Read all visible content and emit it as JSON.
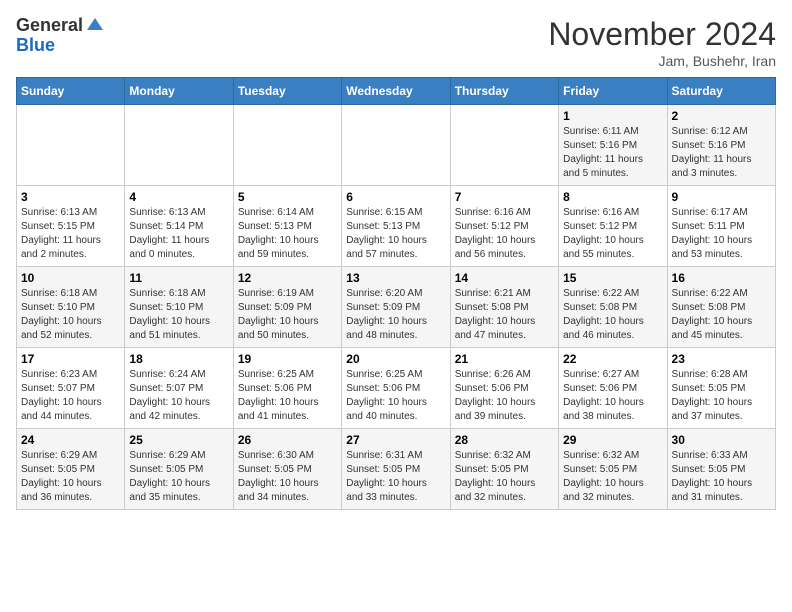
{
  "logo": {
    "general": "General",
    "blue": "Blue"
  },
  "header": {
    "month": "November 2024",
    "location": "Jam, Bushehr, Iran"
  },
  "weekdays": [
    "Sunday",
    "Monday",
    "Tuesday",
    "Wednesday",
    "Thursday",
    "Friday",
    "Saturday"
  ],
  "weeks": [
    [
      {
        "day": "",
        "info": ""
      },
      {
        "day": "",
        "info": ""
      },
      {
        "day": "",
        "info": ""
      },
      {
        "day": "",
        "info": ""
      },
      {
        "day": "",
        "info": ""
      },
      {
        "day": "1",
        "info": "Sunrise: 6:11 AM\nSunset: 5:16 PM\nDaylight: 11 hours\nand 5 minutes."
      },
      {
        "day": "2",
        "info": "Sunrise: 6:12 AM\nSunset: 5:16 PM\nDaylight: 11 hours\nand 3 minutes."
      }
    ],
    [
      {
        "day": "3",
        "info": "Sunrise: 6:13 AM\nSunset: 5:15 PM\nDaylight: 11 hours\nand 2 minutes."
      },
      {
        "day": "4",
        "info": "Sunrise: 6:13 AM\nSunset: 5:14 PM\nDaylight: 11 hours\nand 0 minutes."
      },
      {
        "day": "5",
        "info": "Sunrise: 6:14 AM\nSunset: 5:13 PM\nDaylight: 10 hours\nand 59 minutes."
      },
      {
        "day": "6",
        "info": "Sunrise: 6:15 AM\nSunset: 5:13 PM\nDaylight: 10 hours\nand 57 minutes."
      },
      {
        "day": "7",
        "info": "Sunrise: 6:16 AM\nSunset: 5:12 PM\nDaylight: 10 hours\nand 56 minutes."
      },
      {
        "day": "8",
        "info": "Sunrise: 6:16 AM\nSunset: 5:12 PM\nDaylight: 10 hours\nand 55 minutes."
      },
      {
        "day": "9",
        "info": "Sunrise: 6:17 AM\nSunset: 5:11 PM\nDaylight: 10 hours\nand 53 minutes."
      }
    ],
    [
      {
        "day": "10",
        "info": "Sunrise: 6:18 AM\nSunset: 5:10 PM\nDaylight: 10 hours\nand 52 minutes."
      },
      {
        "day": "11",
        "info": "Sunrise: 6:18 AM\nSunset: 5:10 PM\nDaylight: 10 hours\nand 51 minutes."
      },
      {
        "day": "12",
        "info": "Sunrise: 6:19 AM\nSunset: 5:09 PM\nDaylight: 10 hours\nand 50 minutes."
      },
      {
        "day": "13",
        "info": "Sunrise: 6:20 AM\nSunset: 5:09 PM\nDaylight: 10 hours\nand 48 minutes."
      },
      {
        "day": "14",
        "info": "Sunrise: 6:21 AM\nSunset: 5:08 PM\nDaylight: 10 hours\nand 47 minutes."
      },
      {
        "day": "15",
        "info": "Sunrise: 6:22 AM\nSunset: 5:08 PM\nDaylight: 10 hours\nand 46 minutes."
      },
      {
        "day": "16",
        "info": "Sunrise: 6:22 AM\nSunset: 5:08 PM\nDaylight: 10 hours\nand 45 minutes."
      }
    ],
    [
      {
        "day": "17",
        "info": "Sunrise: 6:23 AM\nSunset: 5:07 PM\nDaylight: 10 hours\nand 44 minutes."
      },
      {
        "day": "18",
        "info": "Sunrise: 6:24 AM\nSunset: 5:07 PM\nDaylight: 10 hours\nand 42 minutes."
      },
      {
        "day": "19",
        "info": "Sunrise: 6:25 AM\nSunset: 5:06 PM\nDaylight: 10 hours\nand 41 minutes."
      },
      {
        "day": "20",
        "info": "Sunrise: 6:25 AM\nSunset: 5:06 PM\nDaylight: 10 hours\nand 40 minutes."
      },
      {
        "day": "21",
        "info": "Sunrise: 6:26 AM\nSunset: 5:06 PM\nDaylight: 10 hours\nand 39 minutes."
      },
      {
        "day": "22",
        "info": "Sunrise: 6:27 AM\nSunset: 5:06 PM\nDaylight: 10 hours\nand 38 minutes."
      },
      {
        "day": "23",
        "info": "Sunrise: 6:28 AM\nSunset: 5:05 PM\nDaylight: 10 hours\nand 37 minutes."
      }
    ],
    [
      {
        "day": "24",
        "info": "Sunrise: 6:29 AM\nSunset: 5:05 PM\nDaylight: 10 hours\nand 36 minutes."
      },
      {
        "day": "25",
        "info": "Sunrise: 6:29 AM\nSunset: 5:05 PM\nDaylight: 10 hours\nand 35 minutes."
      },
      {
        "day": "26",
        "info": "Sunrise: 6:30 AM\nSunset: 5:05 PM\nDaylight: 10 hours\nand 34 minutes."
      },
      {
        "day": "27",
        "info": "Sunrise: 6:31 AM\nSunset: 5:05 PM\nDaylight: 10 hours\nand 33 minutes."
      },
      {
        "day": "28",
        "info": "Sunrise: 6:32 AM\nSunset: 5:05 PM\nDaylight: 10 hours\nand 32 minutes."
      },
      {
        "day": "29",
        "info": "Sunrise: 6:32 AM\nSunset: 5:05 PM\nDaylight: 10 hours\nand 32 minutes."
      },
      {
        "day": "30",
        "info": "Sunrise: 6:33 AM\nSunset: 5:05 PM\nDaylight: 10 hours\nand 31 minutes."
      }
    ]
  ]
}
